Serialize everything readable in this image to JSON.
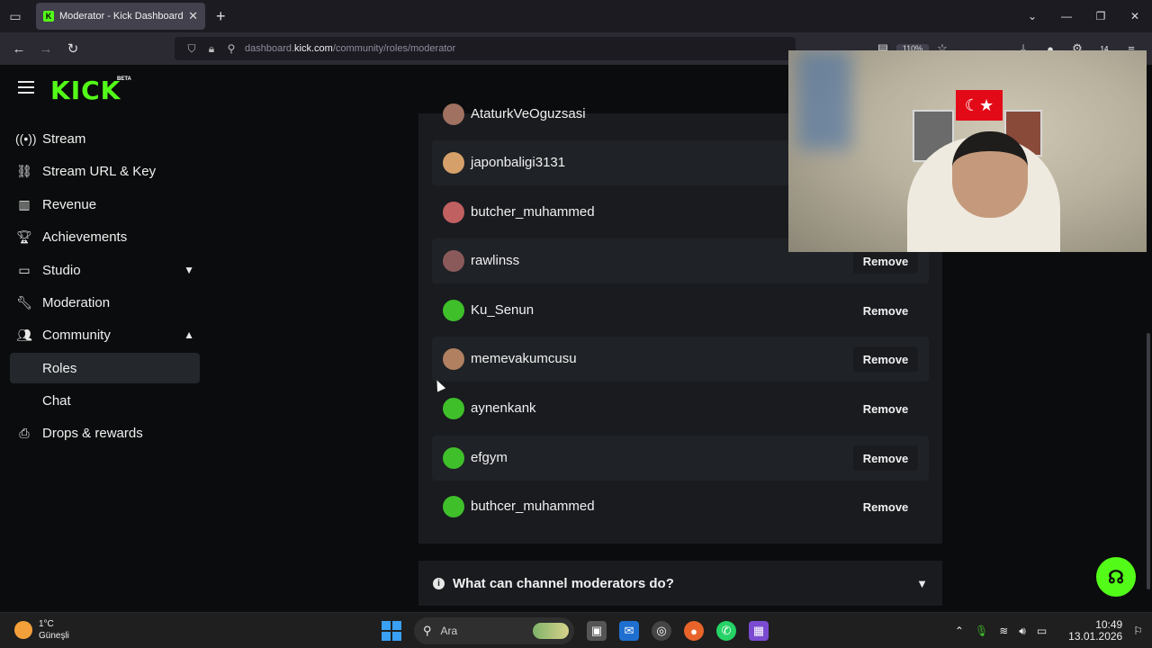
{
  "browser": {
    "tab_title": "Moderator - Kick Dashboard",
    "url_prefix": "dashboard.",
    "url_domain": "kick.com",
    "url_path": "/community/roles/moderator",
    "zoom": "110%",
    "downloads_badge": "14"
  },
  "brand": {
    "logo": "KICK",
    "badge": "BETA",
    "accent": "#53fc18"
  },
  "sidebar": {
    "items": [
      {
        "label": "Stream",
        "icon": "broadcast-icon"
      },
      {
        "label": "Stream URL & Key",
        "icon": "link-icon"
      },
      {
        "label": "Revenue",
        "icon": "chart-icon"
      },
      {
        "label": "Achievements",
        "icon": "trophy-icon"
      },
      {
        "label": "Studio",
        "icon": "monitor-icon"
      },
      {
        "label": "Moderation",
        "icon": "wrench-icon"
      },
      {
        "label": "Community",
        "icon": "users-icon"
      },
      {
        "label": "Roles",
        "icon": ""
      },
      {
        "label": "Chat",
        "icon": ""
      },
      {
        "label": "Drops & rewards",
        "icon": "gift-icon"
      }
    ]
  },
  "moderators": {
    "remove_label": "Remove",
    "rows": [
      {
        "name": "AtaturkVeOguzsasi"
      },
      {
        "name": "japonbaligi3131"
      },
      {
        "name": "butcher_muhammed"
      },
      {
        "name": "rawlinss"
      },
      {
        "name": "Ku_Senun"
      },
      {
        "name": "memevakumcusu"
      },
      {
        "name": "aynenkank"
      },
      {
        "name": "efgym"
      },
      {
        "name": "buthcer_muhammed"
      }
    ]
  },
  "faq": {
    "question": "What can channel moderators do?"
  },
  "taskbar": {
    "temp": "1°C",
    "weather": "Güneşli",
    "search_placeholder": "Ara",
    "time": "10:49",
    "date": "13.01.2026"
  }
}
